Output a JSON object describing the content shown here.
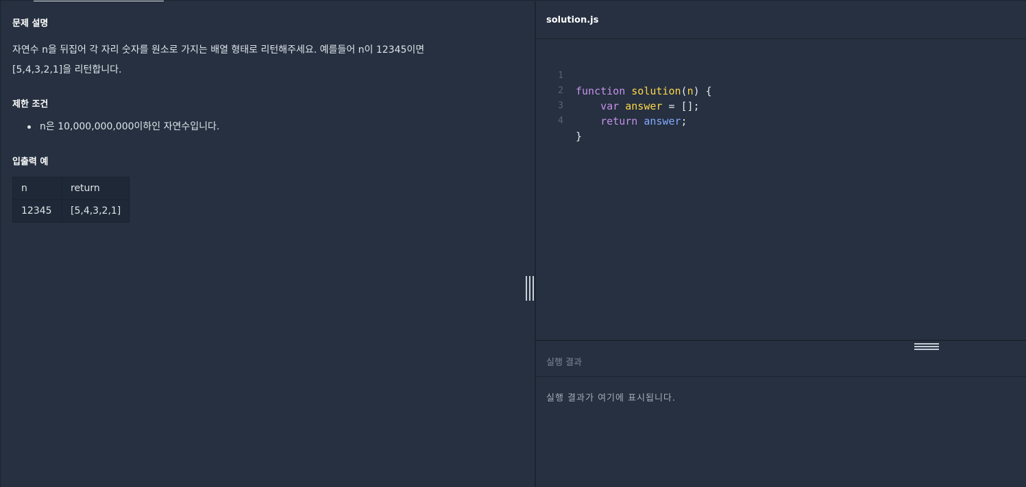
{
  "problem": {
    "description_title": "문제 설명",
    "description_line1": "자연수 n을 뒤집어 각 자리 숫자를 원소로 가지는 배열 형태로 리턴해주세요. 예를들어 n이 12345이면",
    "description_line2": "[5,4,3,2,1]을 리턴합니다.",
    "constraints_title": "제한 조건",
    "constraints": [
      "n은 10,000,000,000이하인 자연수입니다."
    ],
    "io_title": "입출력 예",
    "io_table": {
      "headers": [
        "n",
        "return"
      ],
      "rows": [
        [
          "12345",
          "[5,4,3,2,1]"
        ]
      ]
    }
  },
  "editor": {
    "file_name": "solution.js",
    "line_numbers": [
      "1",
      "2",
      "3",
      "4"
    ],
    "code": {
      "l1_kw": "function",
      "l1_fn": "solution",
      "l1_open": "(",
      "l1_param": "n",
      "l1_close": ") {",
      "l2_kw": "var",
      "l2_var": "answer",
      "l2_rest": " = [];",
      "l3_kw": "return",
      "l3_var": "answer",
      "l3_rest": ";",
      "l4": "}"
    }
  },
  "result": {
    "title": "실행 결과",
    "placeholder": "실행 결과가 여기에 표시됩니다."
  },
  "colors": {
    "background": "#263040",
    "keyword": "#c792ea",
    "function_name": "#ffd84a",
    "variable": "#82aaff"
  }
}
